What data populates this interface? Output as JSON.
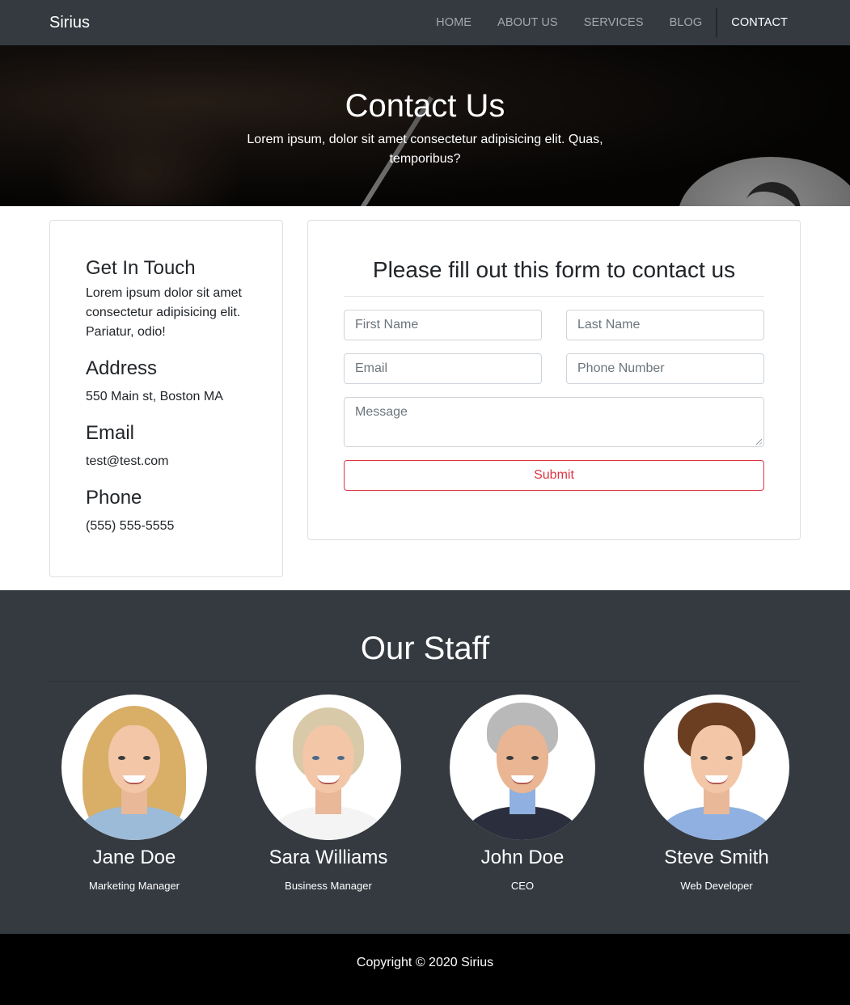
{
  "navbar": {
    "brand": "Sirius",
    "items": [
      {
        "label": "HOME"
      },
      {
        "label": "ABOUT US"
      },
      {
        "label": "SERVICES"
      },
      {
        "label": "BLOG"
      },
      {
        "label": "CONTACT",
        "active": true
      }
    ]
  },
  "hero": {
    "title": "Contact Us",
    "text": "Lorem ipsum, dolor sit amet consectetur adipisicing elit. Quas, temporibus?"
  },
  "info": {
    "touch_heading": "Get In Touch",
    "touch_text": "Lorem ipsum dolor sit amet consectetur adipisicing elit. Pariatur, odio!",
    "address_heading": "Address",
    "address_text": "550 Main st, Boston MA",
    "email_heading": "Email",
    "email_text": "test@test.com",
    "phone_heading": "Phone",
    "phone_text": "(555) 555-5555"
  },
  "form": {
    "title": "Please fill out this form to contact us",
    "first_name_placeholder": "First Name",
    "last_name_placeholder": "Last Name",
    "email_placeholder": "Email",
    "phone_placeholder": "Phone Number",
    "message_placeholder": "Message",
    "submit_label": "Submit"
  },
  "staff": {
    "title": "Our Staff",
    "members": [
      {
        "name": "Jane Doe",
        "role": "Marketing Manager"
      },
      {
        "name": "Sara Williams",
        "role": "Business Manager"
      },
      {
        "name": "John Doe",
        "role": "CEO"
      },
      {
        "name": "Steve Smith",
        "role": "Web Developer"
      }
    ]
  },
  "footer": {
    "copyright": "Copyright © 2020 Sirius"
  },
  "colors": {
    "dark": "#343a40",
    "danger": "#dc3545",
    "footer": "#000000"
  }
}
